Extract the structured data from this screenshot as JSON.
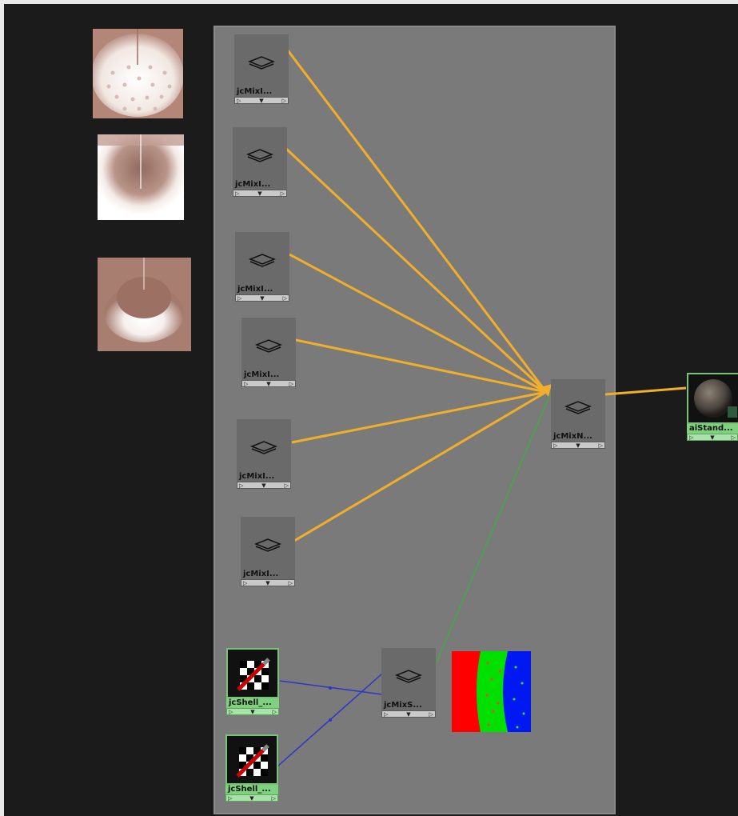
{
  "nodes": {
    "mix1": {
      "label": "jcMixI..."
    },
    "mix2": {
      "label": "jcMixI..."
    },
    "mix3": {
      "label": "jcMixI..."
    },
    "mix4": {
      "label": "jcMixI..."
    },
    "mix5": {
      "label": "jcMixI..."
    },
    "mix6": {
      "label": "jcMixI..."
    },
    "mixN": {
      "label": "jcMixN..."
    },
    "mixS": {
      "label": "jcMixS..."
    },
    "shell1": {
      "label": "jcShell_..."
    },
    "shell2": {
      "label": "jcShell_..."
    },
    "aiStandard": {
      "label": "aiStand..."
    }
  },
  "port_glyphs": {
    "left": "▷",
    "mid": "▼",
    "right": "▷"
  },
  "colors": {
    "background": "#1a1a1a",
    "container": "#7a7a7a",
    "wire_orange": "#f0ae2a",
    "wire_green": "#4f9f52",
    "wire_blue": "#2b36c6",
    "node_selected": "#7fd07f"
  }
}
